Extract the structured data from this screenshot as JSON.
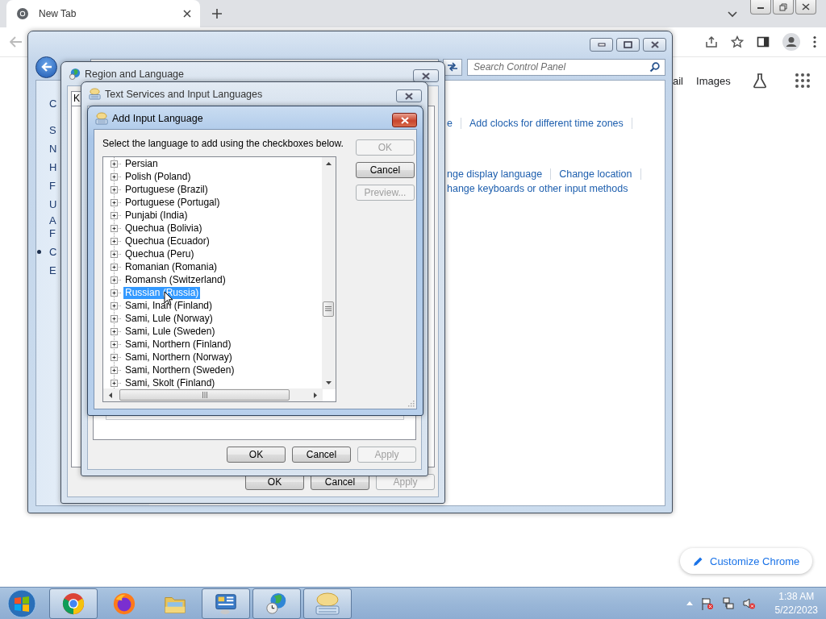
{
  "browser": {
    "tab": {
      "title": "New Tab"
    }
  },
  "new_tab_page": {
    "links": [
      "ail",
      "Images"
    ],
    "customize_button": "Customize Chrome"
  },
  "control_panel": {
    "search": {
      "placeholder": "Search Control Panel"
    },
    "sidebar_fragments": [
      {
        "text": "C",
        "bullet": false
      },
      {
        "text": "S",
        "bullet": false
      },
      {
        "text": "N",
        "bullet": false
      },
      {
        "text": "H",
        "bullet": false
      },
      {
        "text": "F",
        "bullet": false
      },
      {
        "text": "U",
        "bullet": false
      },
      {
        "text": "A",
        "bullet": false
      },
      {
        "text": "F",
        "bullet": false
      },
      {
        "text": "C",
        "bullet": true
      },
      {
        "text": "E",
        "bullet": false
      }
    ],
    "link_rows": [
      [
        "e",
        "Add clocks for different time zones"
      ],
      [
        "nge display language",
        "Change location"
      ],
      [
        "hange keyboards or other input methods"
      ]
    ]
  },
  "region_dialog": {
    "title": "Region and Language",
    "tab_fragment": "K",
    "buttons": [
      {
        "label": "OK",
        "disabled": false
      },
      {
        "label": "Cancel",
        "disabled": false
      },
      {
        "label": "Apply",
        "disabled": true
      }
    ]
  },
  "text_services_dialog": {
    "title": "Text Services and Input Languages",
    "buttons": [
      {
        "label": "OK",
        "disabled": false
      },
      {
        "label": "Cancel",
        "disabled": false
      },
      {
        "label": "Apply",
        "disabled": true
      }
    ]
  },
  "add_language_dialog": {
    "title": "Add Input Language",
    "instruction": "Select the language to add using the checkboxes below.",
    "buttons": [
      {
        "label": "OK",
        "disabled": true
      },
      {
        "label": "Cancel",
        "disabled": false
      },
      {
        "label": "Preview...",
        "disabled": true
      }
    ],
    "languages": [
      {
        "name": "Persian",
        "selected": false
      },
      {
        "name": "Polish (Poland)",
        "selected": false
      },
      {
        "name": "Portuguese (Brazil)",
        "selected": false
      },
      {
        "name": "Portuguese (Portugal)",
        "selected": false
      },
      {
        "name": "Punjabi (India)",
        "selected": false
      },
      {
        "name": "Quechua (Bolivia)",
        "selected": false
      },
      {
        "name": "Quechua (Ecuador)",
        "selected": false
      },
      {
        "name": "Quechua (Peru)",
        "selected": false
      },
      {
        "name": "Romanian (Romania)",
        "selected": false
      },
      {
        "name": "Romansh (Switzerland)",
        "selected": false
      },
      {
        "name": "Russian (Russia)",
        "selected": true
      },
      {
        "name": "Sami, Inari (Finland)",
        "selected": false
      },
      {
        "name": "Sami, Lule (Norway)",
        "selected": false
      },
      {
        "name": "Sami, Lule (Sweden)",
        "selected": false
      },
      {
        "name": "Sami, Northern (Finland)",
        "selected": false
      },
      {
        "name": "Sami, Northern (Norway)",
        "selected": false
      },
      {
        "name": "Sami, Northern (Sweden)",
        "selected": false
      },
      {
        "name": "Sami, Skolt (Finland)",
        "selected": false
      }
    ]
  },
  "taskbar": {
    "apps": [
      {
        "kind": "chrome",
        "running": true
      },
      {
        "kind": "firefox",
        "running": false
      },
      {
        "kind": "explorer",
        "running": false
      },
      {
        "kind": "control-panel",
        "running": true
      },
      {
        "kind": "region",
        "running": true
      },
      {
        "kind": "keyboard",
        "running": true
      }
    ],
    "clock": {
      "time": "1:38 AM",
      "date": "5/22/2023"
    }
  }
}
